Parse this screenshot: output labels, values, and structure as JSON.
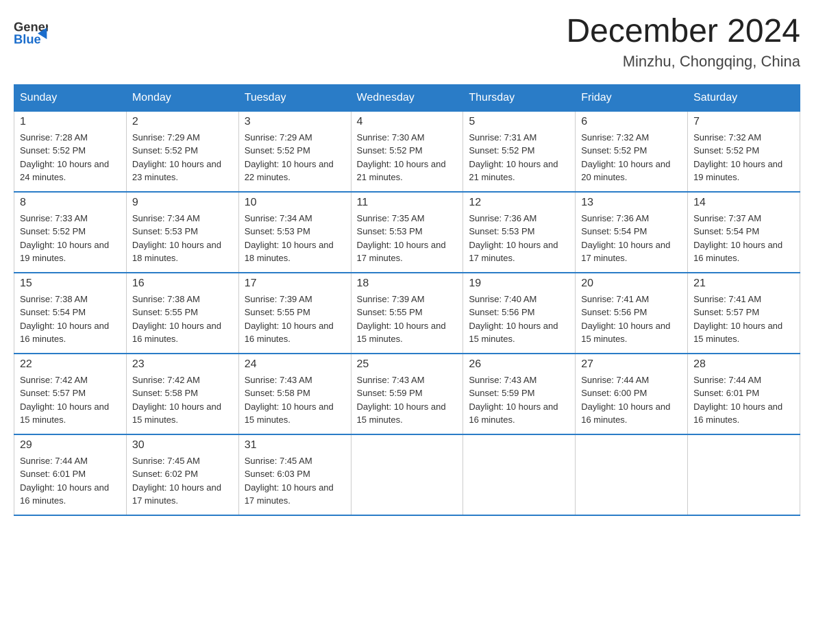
{
  "logo": {
    "text_general": "General",
    "text_blue": "Blue"
  },
  "title": "December 2024",
  "location": "Minzhu, Chongqing, China",
  "weekdays": [
    "Sunday",
    "Monday",
    "Tuesday",
    "Wednesday",
    "Thursday",
    "Friday",
    "Saturday"
  ],
  "weeks": [
    [
      {
        "day": "1",
        "sunrise": "7:28 AM",
        "sunset": "5:52 PM",
        "daylight": "10 hours and 24 minutes."
      },
      {
        "day": "2",
        "sunrise": "7:29 AM",
        "sunset": "5:52 PM",
        "daylight": "10 hours and 23 minutes."
      },
      {
        "day": "3",
        "sunrise": "7:29 AM",
        "sunset": "5:52 PM",
        "daylight": "10 hours and 22 minutes."
      },
      {
        "day": "4",
        "sunrise": "7:30 AM",
        "sunset": "5:52 PM",
        "daylight": "10 hours and 21 minutes."
      },
      {
        "day": "5",
        "sunrise": "7:31 AM",
        "sunset": "5:52 PM",
        "daylight": "10 hours and 21 minutes."
      },
      {
        "day": "6",
        "sunrise": "7:32 AM",
        "sunset": "5:52 PM",
        "daylight": "10 hours and 20 minutes."
      },
      {
        "day": "7",
        "sunrise": "7:32 AM",
        "sunset": "5:52 PM",
        "daylight": "10 hours and 19 minutes."
      }
    ],
    [
      {
        "day": "8",
        "sunrise": "7:33 AM",
        "sunset": "5:52 PM",
        "daylight": "10 hours and 19 minutes."
      },
      {
        "day": "9",
        "sunrise": "7:34 AM",
        "sunset": "5:53 PM",
        "daylight": "10 hours and 18 minutes."
      },
      {
        "day": "10",
        "sunrise": "7:34 AM",
        "sunset": "5:53 PM",
        "daylight": "10 hours and 18 minutes."
      },
      {
        "day": "11",
        "sunrise": "7:35 AM",
        "sunset": "5:53 PM",
        "daylight": "10 hours and 17 minutes."
      },
      {
        "day": "12",
        "sunrise": "7:36 AM",
        "sunset": "5:53 PM",
        "daylight": "10 hours and 17 minutes."
      },
      {
        "day": "13",
        "sunrise": "7:36 AM",
        "sunset": "5:54 PM",
        "daylight": "10 hours and 17 minutes."
      },
      {
        "day": "14",
        "sunrise": "7:37 AM",
        "sunset": "5:54 PM",
        "daylight": "10 hours and 16 minutes."
      }
    ],
    [
      {
        "day": "15",
        "sunrise": "7:38 AM",
        "sunset": "5:54 PM",
        "daylight": "10 hours and 16 minutes."
      },
      {
        "day": "16",
        "sunrise": "7:38 AM",
        "sunset": "5:55 PM",
        "daylight": "10 hours and 16 minutes."
      },
      {
        "day": "17",
        "sunrise": "7:39 AM",
        "sunset": "5:55 PM",
        "daylight": "10 hours and 16 minutes."
      },
      {
        "day": "18",
        "sunrise": "7:39 AM",
        "sunset": "5:55 PM",
        "daylight": "10 hours and 15 minutes."
      },
      {
        "day": "19",
        "sunrise": "7:40 AM",
        "sunset": "5:56 PM",
        "daylight": "10 hours and 15 minutes."
      },
      {
        "day": "20",
        "sunrise": "7:41 AM",
        "sunset": "5:56 PM",
        "daylight": "10 hours and 15 minutes."
      },
      {
        "day": "21",
        "sunrise": "7:41 AM",
        "sunset": "5:57 PM",
        "daylight": "10 hours and 15 minutes."
      }
    ],
    [
      {
        "day": "22",
        "sunrise": "7:42 AM",
        "sunset": "5:57 PM",
        "daylight": "10 hours and 15 minutes."
      },
      {
        "day": "23",
        "sunrise": "7:42 AM",
        "sunset": "5:58 PM",
        "daylight": "10 hours and 15 minutes."
      },
      {
        "day": "24",
        "sunrise": "7:43 AM",
        "sunset": "5:58 PM",
        "daylight": "10 hours and 15 minutes."
      },
      {
        "day": "25",
        "sunrise": "7:43 AM",
        "sunset": "5:59 PM",
        "daylight": "10 hours and 15 minutes."
      },
      {
        "day": "26",
        "sunrise": "7:43 AM",
        "sunset": "5:59 PM",
        "daylight": "10 hours and 16 minutes."
      },
      {
        "day": "27",
        "sunrise": "7:44 AM",
        "sunset": "6:00 PM",
        "daylight": "10 hours and 16 minutes."
      },
      {
        "day": "28",
        "sunrise": "7:44 AM",
        "sunset": "6:01 PM",
        "daylight": "10 hours and 16 minutes."
      }
    ],
    [
      {
        "day": "29",
        "sunrise": "7:44 AM",
        "sunset": "6:01 PM",
        "daylight": "10 hours and 16 minutes."
      },
      {
        "day": "30",
        "sunrise": "7:45 AM",
        "sunset": "6:02 PM",
        "daylight": "10 hours and 17 minutes."
      },
      {
        "day": "31",
        "sunrise": "7:45 AM",
        "sunset": "6:03 PM",
        "daylight": "10 hours and 17 minutes."
      },
      null,
      null,
      null,
      null
    ]
  ]
}
